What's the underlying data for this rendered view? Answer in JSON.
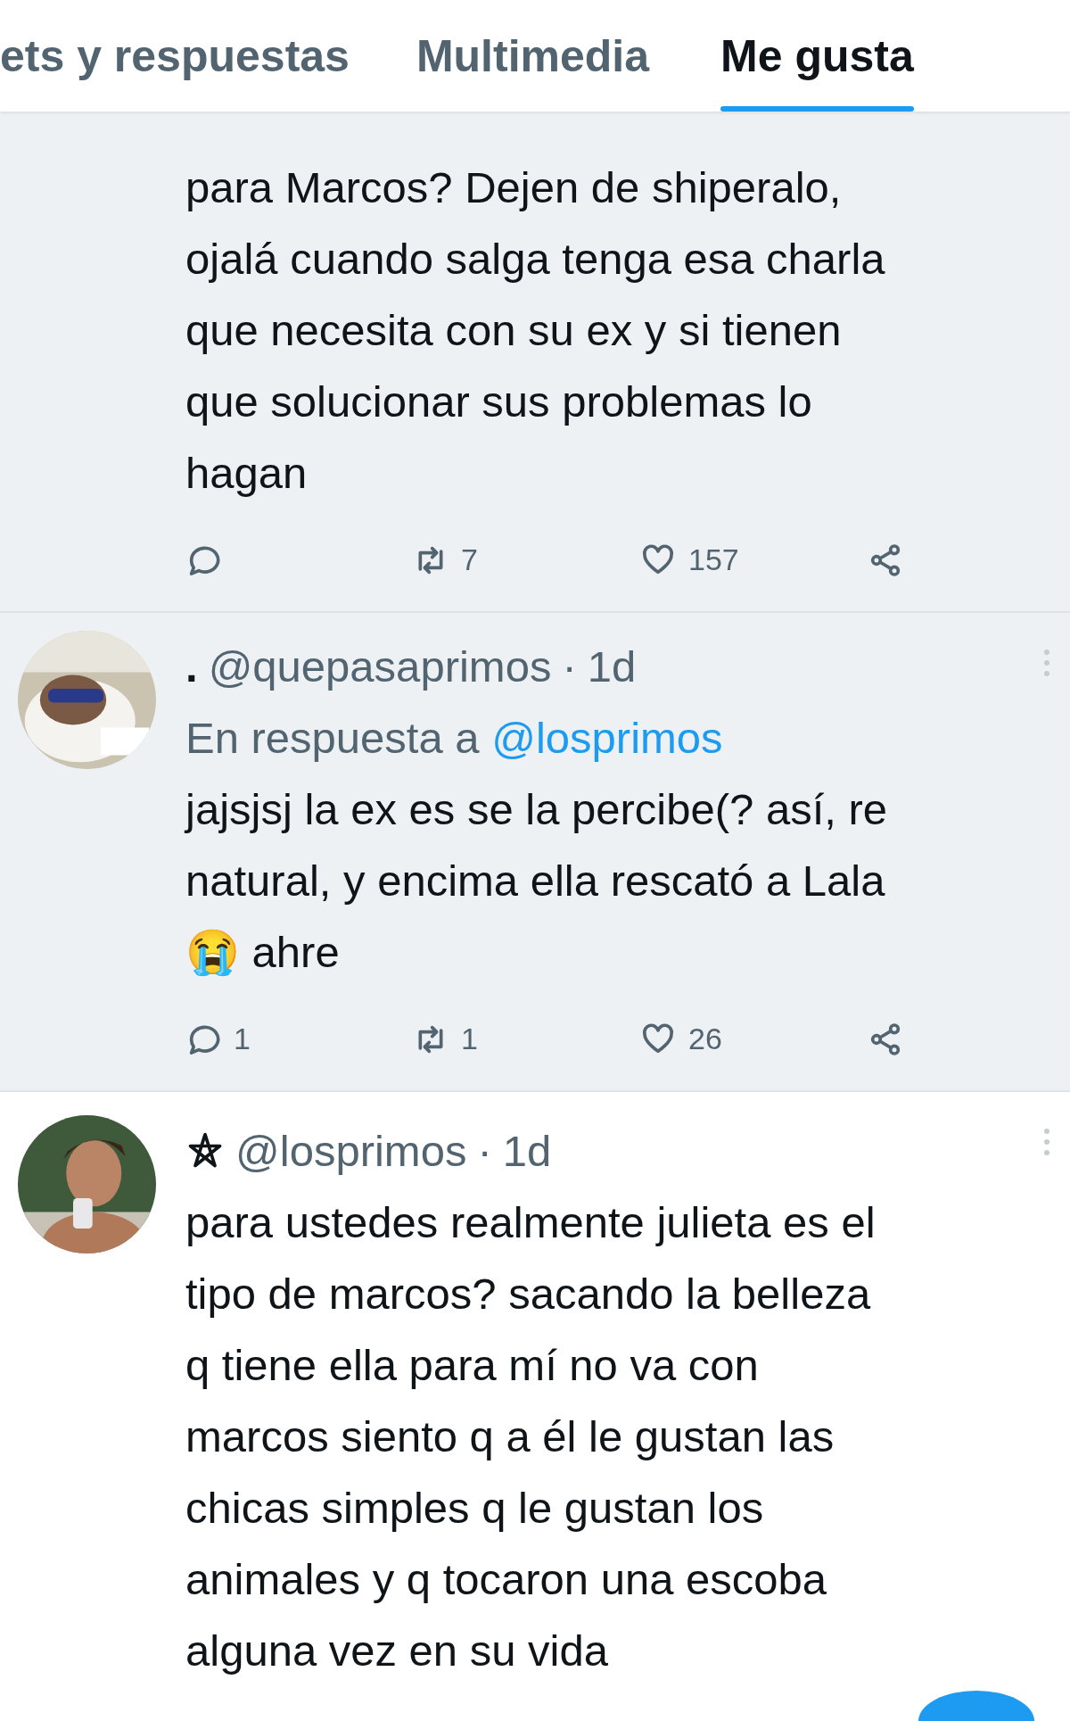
{
  "tabs": [
    {
      "label": "ets y respuestas",
      "selected": false
    },
    {
      "label": "Multimedia",
      "selected": false
    },
    {
      "label": "Me gusta",
      "selected": true
    }
  ],
  "tweets": [
    {
      "highlighted": true,
      "text": "para Marcos? Dejen de shiperalo,\nojalá cuando salga tenga esa charla\nque necesita con su ex y si tienen\nque solucionar sus problemas lo\nhagan",
      "actions": [
        {
          "kind": "reply"
        },
        {
          "kind": "retweet",
          "count": "7"
        },
        {
          "kind": "like",
          "count": "157"
        },
        {
          "kind": "share"
        }
      ]
    },
    {
      "highlighted": true,
      "name": ".",
      "handle": "@quepasaprimos",
      "separator": "·",
      "time": "1d",
      "reply_prefix": "En respuesta a",
      "reply_to": "@losprimos",
      "text": "jajsjsj la ex es se la percibe(? así, re\nnatural, y encima ella rescató a Lala\n😭 ahre",
      "actions": [
        {
          "kind": "reply",
          "count": "1"
        },
        {
          "kind": "retweet",
          "count": "1"
        },
        {
          "kind": "like",
          "count": "26"
        },
        {
          "kind": "share"
        }
      ]
    },
    {
      "highlighted": false,
      "name_badge": {
        "kind": "star"
      },
      "handle": "@losprimos",
      "separator": "·",
      "time": "1d",
      "text": "para ustedes realmente julieta es el\ntipo de marcos? sacando la belleza\nq tiene ella para mí no va con\nmarcos siento q a él le gustan las\nchicas simples q le gustan los\nanimales y q tocaron una escoba\nalguna vez en su vida"
    }
  ]
}
